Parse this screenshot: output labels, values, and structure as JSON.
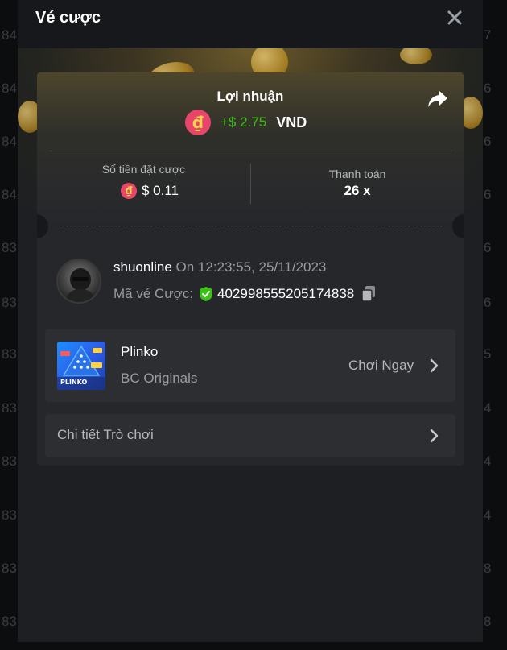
{
  "modal": {
    "title": "Vé cược",
    "close_icon": "close-icon"
  },
  "background_numbers": {
    "left": [
      "84",
      "84",
      "84",
      "84",
      "83",
      "83",
      "83",
      "83",
      "83",
      "83",
      "83",
      "83"
    ],
    "right": [
      "7",
      "6",
      "6",
      "6",
      "6",
      "6",
      "5",
      "4",
      "4",
      "4",
      "8",
      "8"
    ]
  },
  "ticket": {
    "profit_label": "Lợi nhuận",
    "currency_symbol": "₫",
    "profit_value": "+$ 2.75",
    "profit_currency": "VND",
    "share_icon": "share-icon",
    "bet_amount_label": "Số tiền đặt cược",
    "bet_amount_value": "$ 0.11",
    "payout_label": "Thanh toán",
    "payout_value": "26 x",
    "user": {
      "username": "shuonline",
      "time_text": "On 12:23:55, 25/11/2023",
      "ticket_label": "Mã vé Cược:",
      "ticket_id": "402998555205174838"
    },
    "game": {
      "name": "Plinko",
      "provider": "BC Originals",
      "play_label": "Chơi Ngay",
      "thumb_text": "PLINKO"
    },
    "details_label": "Chi tiết Trò chơi"
  },
  "colors": {
    "profit_green": "#3bc117",
    "coin_red": "#e8456b",
    "coin_gold": "#f7d34a",
    "verified_green": "#3bc117"
  }
}
